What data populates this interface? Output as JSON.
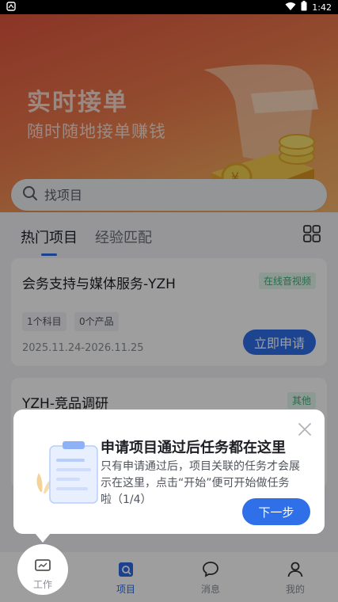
{
  "status_bar": {
    "time": "1:42"
  },
  "banner": {
    "title": "实时接单",
    "subtitle": "随时随地接单赚钱"
  },
  "search": {
    "placeholder": "找项目"
  },
  "tabs": [
    {
      "label": "热门项目"
    },
    {
      "label": "经验匹配"
    }
  ],
  "projects": [
    {
      "title": "会务支持与媒体服务-YZH",
      "tag": "在线音视频",
      "chips": [
        "1个科目",
        "0个产品"
      ],
      "date": "2025.11.24-2026.11.25",
      "button": "立即申请"
    },
    {
      "title": "YZH-竞品调研",
      "tag": "其他"
    }
  ],
  "guide": {
    "title": "申请项目通过后任务都在这里",
    "text": "只有申请通过后，项目关联的任务才会展示在这里，点击“开始”便可开始做任务啦（1/4）",
    "next": "下一步"
  },
  "bottom_nav": [
    {
      "label": "工作"
    },
    {
      "label": "项目"
    },
    {
      "label": "消息"
    },
    {
      "label": "我的"
    }
  ],
  "colors": {
    "primary": "#2f6fe8",
    "banner_start": "#e0553f",
    "banner_end": "#f5b46b",
    "tag_green": "#3bb37a"
  }
}
